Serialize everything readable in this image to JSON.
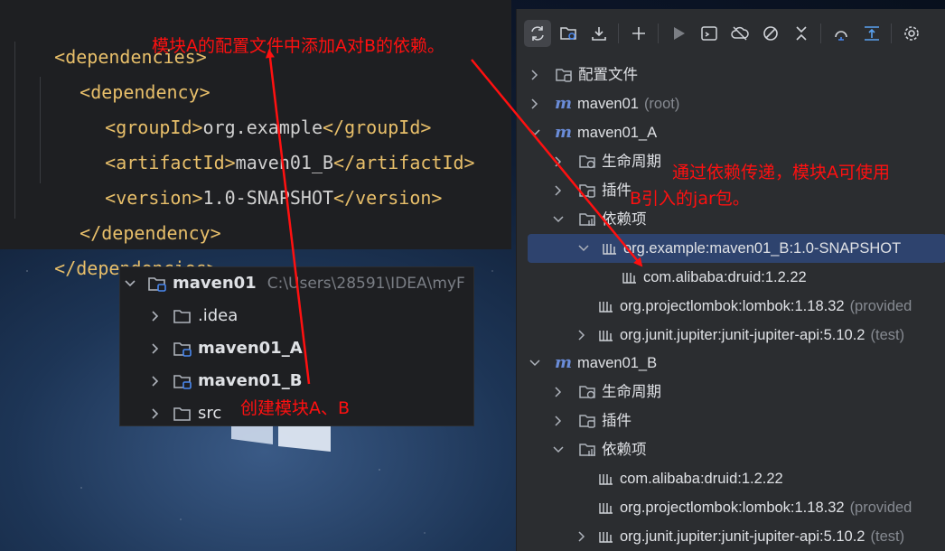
{
  "code": {
    "lines": [
      {
        "open": "<dependencies>",
        "text": "",
        "close": ""
      },
      {
        "open": "<dependency>",
        "text": "",
        "close": ""
      },
      {
        "open": "<groupId>",
        "text": "org.example",
        "close": "</groupId>"
      },
      {
        "open": "<artifactId>",
        "text": "maven01_B",
        "close": "</artifactId>"
      },
      {
        "open": "<version>",
        "text": "1.0-SNAPSHOT",
        "close": "</version>"
      },
      {
        "open": "</dependency>",
        "text": "",
        "close": ""
      },
      {
        "open": "</dependencies>",
        "text": "",
        "close": ""
      }
    ]
  },
  "project_tree": {
    "root_name": "maven01",
    "root_path": "C:\\Users\\28591\\IDEA\\myF",
    "items": [
      ".idea",
      "maven01_A",
      "maven01_B",
      "src"
    ]
  },
  "maven_panel": {
    "toolbar_icons": [
      "reload-icon",
      "reimport-folder-icon",
      "download-icon",
      "add-icon",
      "run-icon",
      "execute-goal-icon",
      "offline-icon",
      "skip-tests-icon",
      "collapse-icon",
      "show-dependencies-icon",
      "align-icon",
      "settings-icon"
    ],
    "rows": {
      "config": "配置文件",
      "maven01": "maven01",
      "maven01_root": "(root)",
      "maven01_a": "maven01_A",
      "a_lifecycle": "生命周期",
      "a_plugins": "插件",
      "a_deps": "依赖项",
      "a_dep_b": "org.example:maven01_B:1.0-SNAPSHOT",
      "a_dep_druid": "com.alibaba:druid:1.2.22",
      "a_dep_lombok": "org.projectlombok:lombok:1.18.32",
      "a_dep_lombok_scope": "(provided",
      "a_dep_junit": "org.junit.jupiter:junit-jupiter-api:5.10.2",
      "a_dep_junit_scope": "(test)",
      "maven01_b": "maven01_B",
      "b_lifecycle": "生命周期",
      "b_plugins": "插件",
      "b_deps": "依赖项",
      "b_dep_druid": "com.alibaba:druid:1.2.22",
      "b_dep_lombok": "org.projectlombok:lombok:1.18.32",
      "b_dep_lombok_scope": "(provided",
      "b_dep_junit": "org.junit.jupiter:junit-jupiter-api:5.10.2",
      "b_dep_junit_scope": "(test)"
    }
  },
  "annotations": {
    "add_dependency": "模块A的配置文件中添加A对B的依赖。",
    "transitive_1": "通过依赖传递，模块A可使用",
    "transitive_2": "B引入的jar包。",
    "create_modules": "创建模块A、B"
  },
  "colors": {
    "annotation": "#ff1010",
    "xml_tag": "#e8bf6a",
    "selected_row": "#2e436e"
  }
}
